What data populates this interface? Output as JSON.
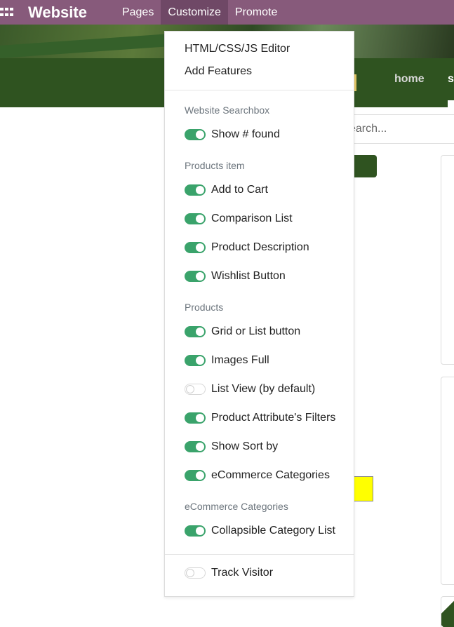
{
  "topbar": {
    "brand": "Website",
    "menu": [
      "Pages",
      "Customize",
      "Promote"
    ]
  },
  "site": {
    "nav_home": "home",
    "nav_partial": "s",
    "search_placeholder": "earch..."
  },
  "dropdown": {
    "links": [
      "HTML/CSS/JS Editor",
      "Add Features"
    ],
    "sections": [
      {
        "header": "Website Searchbox",
        "options": [
          {
            "label": "Show # found",
            "enabled": true
          }
        ]
      },
      {
        "header": "Products item",
        "options": [
          {
            "label": "Add to Cart",
            "enabled": true
          },
          {
            "label": "Comparison List",
            "enabled": true
          },
          {
            "label": "Product Description",
            "enabled": true
          },
          {
            "label": "Wishlist Button",
            "enabled": true
          }
        ]
      },
      {
        "header": "Products",
        "options": [
          {
            "label": "Grid or List button",
            "enabled": true
          },
          {
            "label": "Images Full",
            "enabled": true
          },
          {
            "label": "List View (by default)",
            "enabled": false
          },
          {
            "label": "Product Attribute's Filters",
            "enabled": true
          },
          {
            "label": "Show Sort by",
            "enabled": true
          },
          {
            "label": "eCommerce Categories",
            "enabled": true
          }
        ]
      },
      {
        "header": "eCommerce Categories",
        "options": [
          {
            "label": "Collapsible Category List",
            "enabled": true
          }
        ]
      }
    ],
    "footer_option": {
      "label": "Track Visitor",
      "enabled": false
    }
  },
  "colors": {
    "topbar": "#875a7b",
    "toggle_on": "#3aa36b",
    "site_green": "#2f5320"
  }
}
